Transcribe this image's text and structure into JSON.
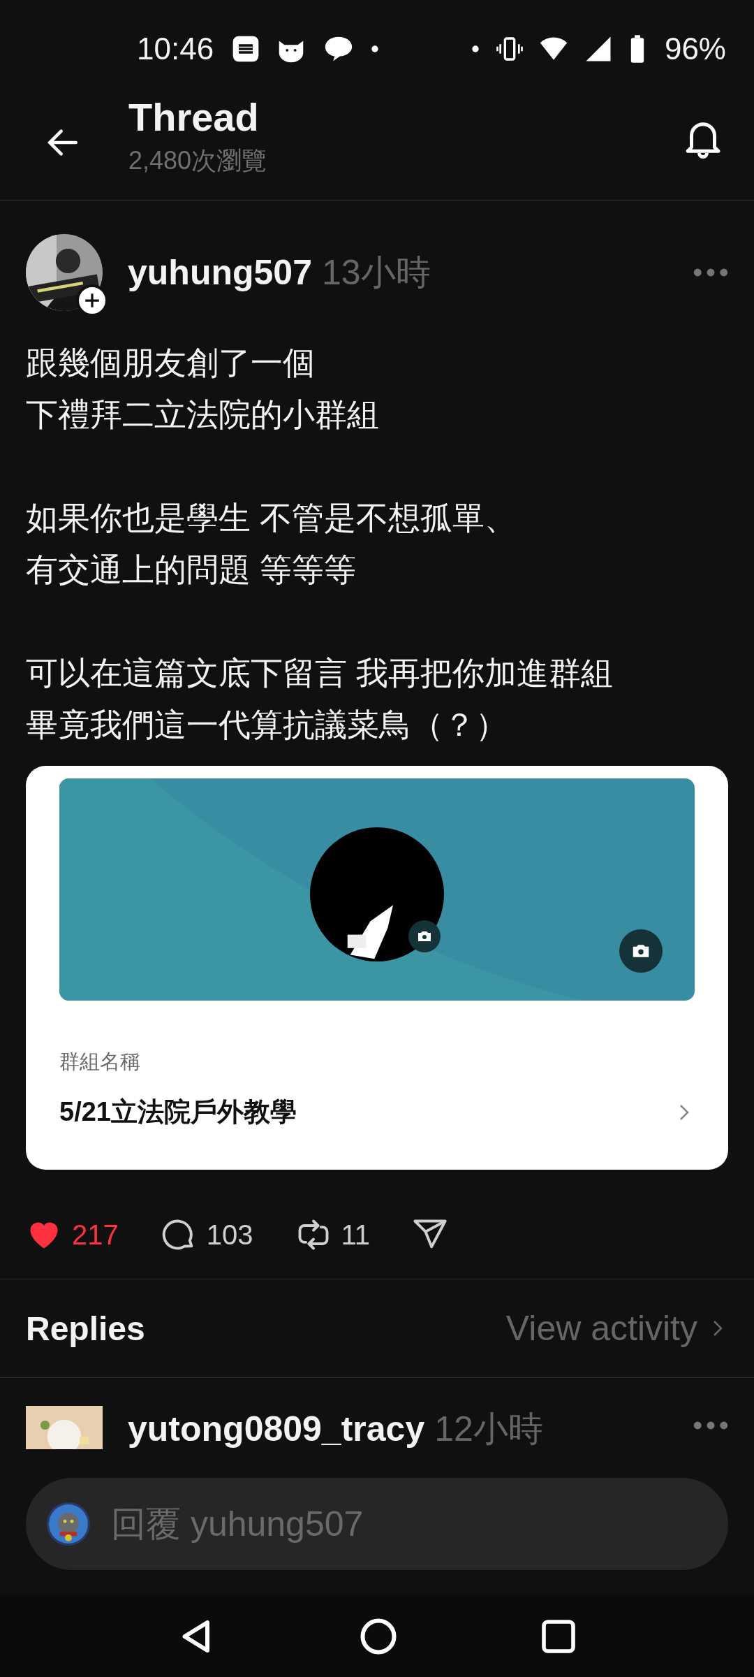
{
  "status_bar": {
    "time": "10:46",
    "battery": "96%"
  },
  "header": {
    "title": "Thread",
    "views": "2,480次瀏覽"
  },
  "post": {
    "username": "yuhung507",
    "time": "13小時",
    "following": false,
    "paragraphs": [
      [
        "跟幾個朋友創了一個",
        "下禮拜二立法院的小群組"
      ],
      [
        "如果你也是學生 不管是不想孤單、",
        "有交通上的問題 等等等"
      ],
      [
        "可以在這篇文底下留言 我再把你加進群組",
        "畢竟我們這一代算抗議菜鳥（？）"
      ]
    ],
    "attachment": {
      "field_label": "群組名稱",
      "group_name": "5/21立法院戶外教學"
    },
    "actions": [
      {
        "kind": "like",
        "count": "217",
        "selected": true
      },
      {
        "kind": "comment",
        "count": "103"
      },
      {
        "kind": "repost",
        "count": "11"
      },
      {
        "kind": "share"
      }
    ]
  },
  "replies": {
    "title": "Replies",
    "link": "View activity"
  },
  "reply_items": [
    {
      "username": "yutong0809_tracy",
      "time": "12小時"
    }
  ],
  "composer": {
    "placeholder": "回覆 yuhung507"
  }
}
